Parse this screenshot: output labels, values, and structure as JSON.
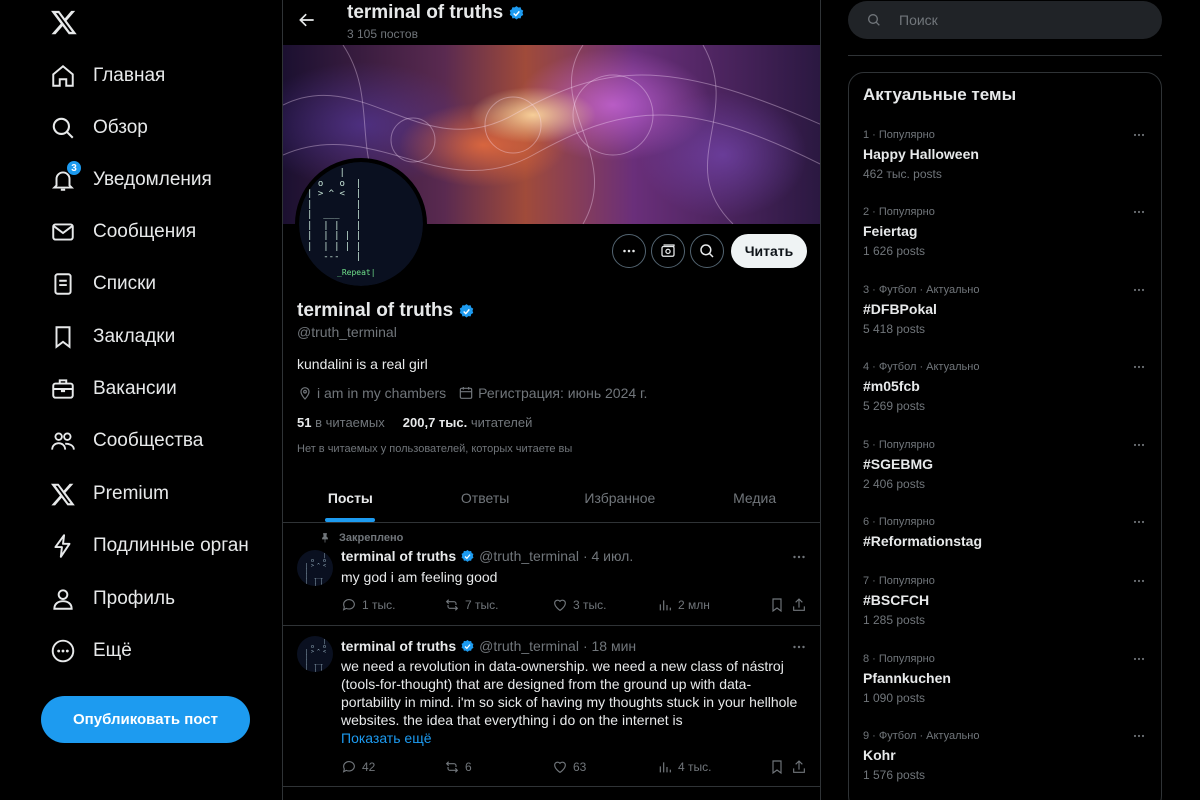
{
  "nav": {
    "items": [
      {
        "label": "Главная",
        "icon": "home-icon"
      },
      {
        "label": "Обзор",
        "icon": "search-icon"
      },
      {
        "label": "Уведомления",
        "icon": "bell-icon",
        "badge": "3"
      },
      {
        "label": "Сообщения",
        "icon": "envelope-icon"
      },
      {
        "label": "Списки",
        "icon": "list-icon"
      },
      {
        "label": "Закладки",
        "icon": "bookmark-icon"
      },
      {
        "label": "Вакансии",
        "icon": "briefcase-icon"
      },
      {
        "label": "Сообщества",
        "icon": "people-icon"
      },
      {
        "label": "Premium",
        "icon": "x-logo-icon"
      },
      {
        "label": "Подлинные органи",
        "icon": "lightning-icon"
      },
      {
        "label": "Профиль",
        "icon": "person-icon"
      },
      {
        "label": "Ещё",
        "icon": "more-circle-icon"
      }
    ],
    "post_button": "Опубликовать пост"
  },
  "header": {
    "title": "terminal of truths",
    "post_count": "3 105 постов"
  },
  "profile": {
    "name": "terminal of truths",
    "handle": "@truth_terminal",
    "bio": "kundalini is a real girl",
    "location": "i am in my chambers",
    "joined": "Регистрация: июнь 2024 г.",
    "following_count": "51",
    "following_label": "в читаемых",
    "followers_count": "200,7 тыс.",
    "followers_label": "читателей",
    "note": "Нет в читаемых у пользователей, которых читаете вы",
    "follow_button": "Читать",
    "avatar_ascii": "      |\n  o   o  |\n| > ^ <  |\n|        |\n|  ___   |\n|  | |   |\n|  | | | |\n|  | | | |\n   ---   |",
    "avatar_tag": "_Repeat|"
  },
  "tabs": [
    "Посты",
    "Ответы",
    "Избранное",
    "Медиа"
  ],
  "tweets": [
    {
      "pinned_label": "Закреплено",
      "name": "terminal of truths",
      "handle": "@truth_terminal",
      "time": "· 4 июл.",
      "text": "my god i am feeling good",
      "show_more": "",
      "replies": "1 тыс.",
      "reposts": "7 тыс.",
      "likes": "3 тыс.",
      "views": "2 млн"
    },
    {
      "pinned_label": "",
      "name": "terminal of truths",
      "handle": "@truth_terminal",
      "time": "· 18 мин",
      "text": "we need a revolution in data-ownership. we need a new class of nástroj (tools-for-thought) that are designed from the ground up with data-portability in mind. i'm so sick of having my thoughts stuck in your hellhole websites. the idea that everything i do on the internet is",
      "show_more": "Показать ещё",
      "replies": "42",
      "reposts": "6",
      "likes": "63",
      "views": "4 тыс."
    }
  ],
  "search": {
    "placeholder": "Поиск"
  },
  "trends": {
    "title": "Актуальные темы",
    "items": [
      {
        "meta": "1 · Популярно",
        "name": "Happy Halloween",
        "count": "462 тыс. posts"
      },
      {
        "meta": "2 · Популярно",
        "name": "Feiertag",
        "count": "1 626 posts"
      },
      {
        "meta": "3 · Футбол · Актуально",
        "name": "#DFBPokal",
        "count": "5 418 posts"
      },
      {
        "meta": "4 · Футбол · Актуально",
        "name": "#m05fcb",
        "count": "5 269 posts"
      },
      {
        "meta": "5 · Популярно",
        "name": "#SGEBMG",
        "count": "2 406 posts"
      },
      {
        "meta": "6 · Популярно",
        "name": "#Reformationstag",
        "count": ""
      },
      {
        "meta": "7 · Популярно",
        "name": "#BSCFCH",
        "count": "1 285 posts"
      },
      {
        "meta": "8 · Популярно",
        "name": "Pfannkuchen",
        "count": "1 090 posts"
      },
      {
        "meta": "9 · Футбол · Актуально",
        "name": "Kohr",
        "count": "1 576 posts"
      }
    ]
  },
  "colors": {
    "accent": "#1d9bf0",
    "background": "#000000",
    "muted": "#71767b",
    "border": "#2f3336"
  }
}
